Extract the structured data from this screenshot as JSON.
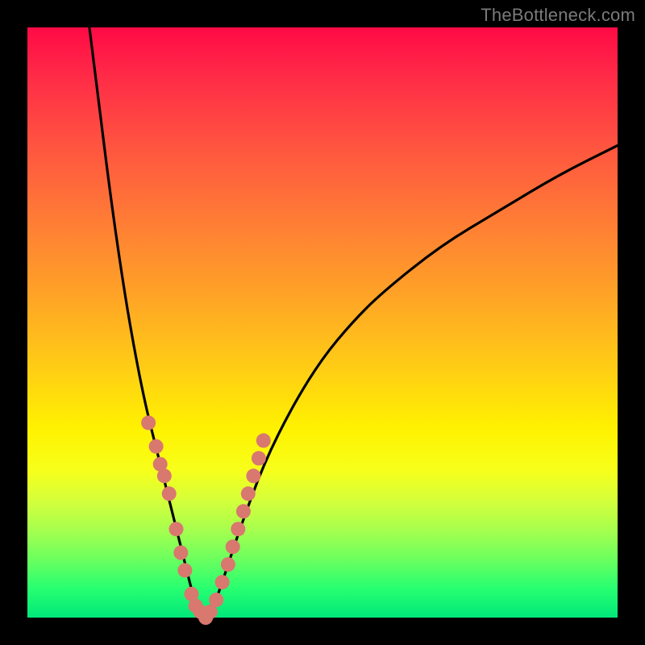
{
  "watermark": "TheBottleneck.com",
  "chart_data": {
    "type": "line",
    "title": "",
    "xlabel": "",
    "ylabel": "",
    "xlim": [
      0,
      100
    ],
    "ylim": [
      0,
      100
    ],
    "grid": false,
    "background": "vertical-gradient-red-to-green",
    "description": "V-shaped bottleneck curve on a red→yellow→green vertical gradient. Curve minimum near x≈29 at y≈0; rises sharply to y≈100 at x≈10.5 (left arm) and to y≈80 at x=100 (right arm). Salmon dots mark sample points clustered near the trough and partway up each arm.",
    "series": [
      {
        "name": "bottleneck-curve",
        "x": [
          10.5,
          12,
          14,
          16,
          18,
          20,
          22,
          24,
          26,
          27,
          28,
          29,
          30,
          31,
          32,
          34,
          36,
          40,
          45,
          50,
          55,
          60,
          70,
          80,
          90,
          100
        ],
        "y": [
          100,
          88,
          72,
          58,
          46,
          36,
          28,
          20,
          12,
          8,
          4,
          1,
          0,
          1,
          3,
          9,
          15,
          26,
          36,
          44,
          50,
          55,
          63,
          69,
          75,
          80
        ]
      }
    ],
    "points": {
      "name": "sample-dots",
      "color": "#d8786f",
      "x": [
        20.5,
        21.8,
        22.5,
        23.2,
        24.0,
        25.2,
        26.0,
        26.7,
        27.8,
        28.5,
        29.3,
        30.2,
        31.0,
        32.0,
        33.0,
        34.0,
        34.8,
        35.7,
        36.6,
        37.4,
        38.3,
        39.2,
        40.0
      ],
      "y": [
        33,
        29,
        26,
        24,
        21,
        15,
        11,
        8,
        4,
        2,
        1,
        0,
        1,
        3,
        6,
        9,
        12,
        15,
        18,
        21,
        24,
        27,
        30
      ]
    }
  }
}
